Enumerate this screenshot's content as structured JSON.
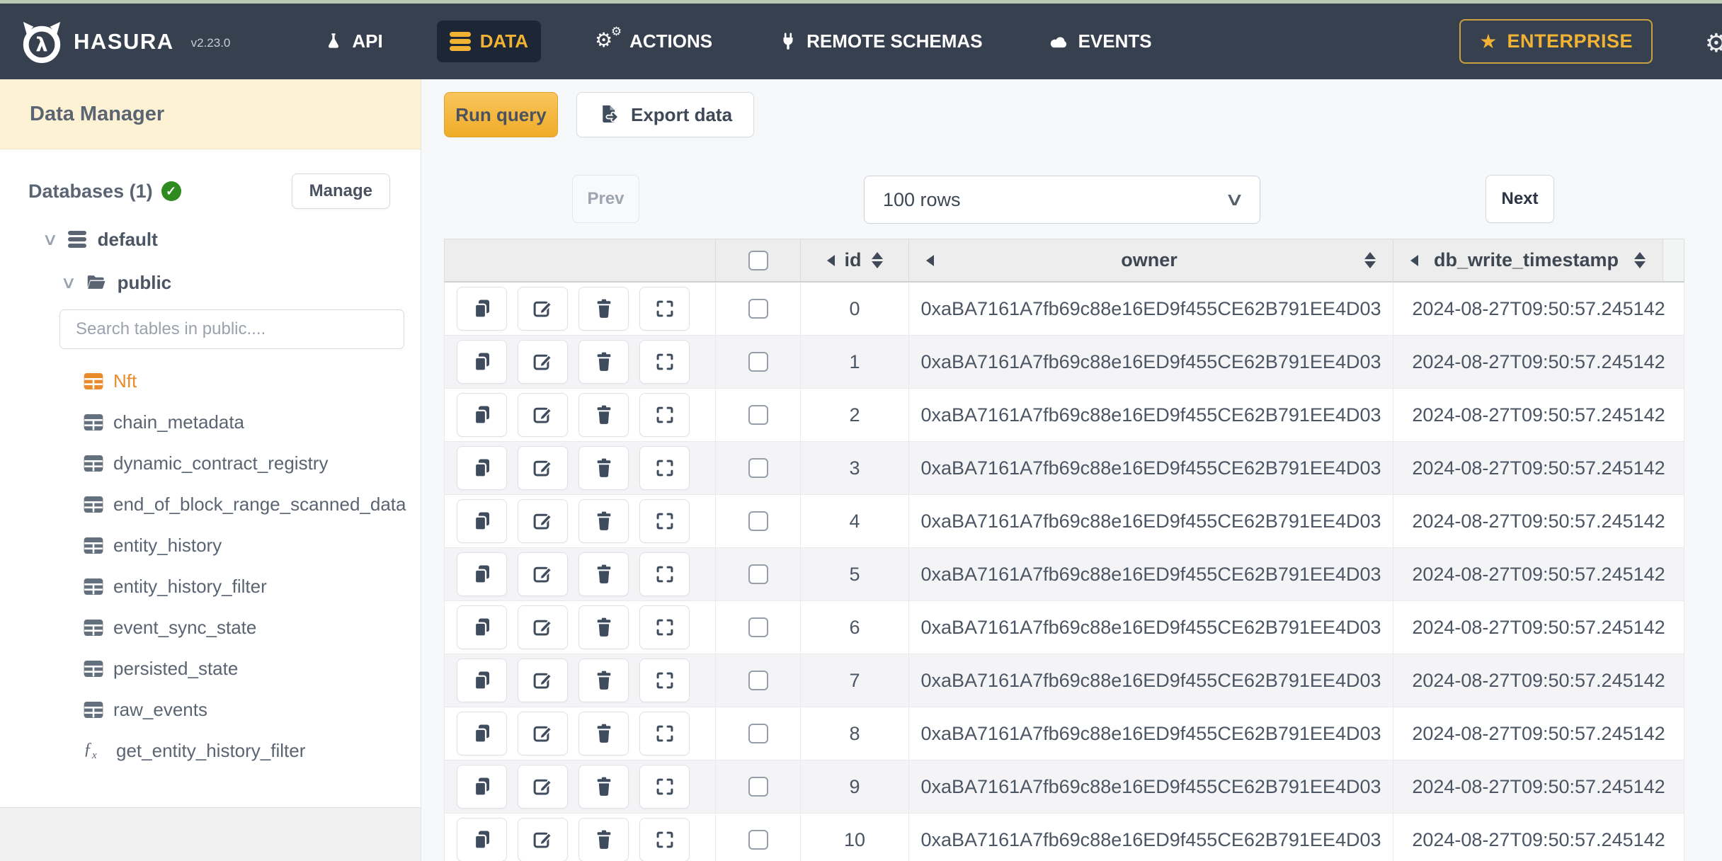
{
  "navbar": {
    "brand": "HASURA",
    "version": "v2.23.0",
    "items": [
      {
        "label": "API",
        "icon": "flask-icon",
        "active": false
      },
      {
        "label": "DATA",
        "icon": "database-icon",
        "active": true
      },
      {
        "label": "ACTIONS",
        "icon": "gears-icon",
        "active": false
      },
      {
        "label": "REMOTE SCHEMAS",
        "icon": "plug-icon",
        "active": false
      },
      {
        "label": "EVENTS",
        "icon": "cloud-icon",
        "active": false
      }
    ],
    "enterprise_label": "ENTERPRISE"
  },
  "sidebar": {
    "title": "Data Manager",
    "databases_label": "Databases (1)",
    "manage_label": "Manage",
    "tree": {
      "database": "default",
      "schema": "public"
    },
    "search_placeholder": "Search tables in public....",
    "tables": [
      {
        "name": "Nft",
        "type": "table",
        "active": true
      },
      {
        "name": "chain_metadata",
        "type": "table",
        "active": false
      },
      {
        "name": "dynamic_contract_registry",
        "type": "table",
        "active": false
      },
      {
        "name": "end_of_block_range_scanned_data",
        "type": "table",
        "active": false
      },
      {
        "name": "entity_history",
        "type": "table",
        "active": false
      },
      {
        "name": "entity_history_filter",
        "type": "table",
        "active": false
      },
      {
        "name": "event_sync_state",
        "type": "table",
        "active": false
      },
      {
        "name": "persisted_state",
        "type": "table",
        "active": false
      },
      {
        "name": "raw_events",
        "type": "table",
        "active": false
      },
      {
        "name": "get_entity_history_filter",
        "type": "function",
        "active": false
      }
    ]
  },
  "toolbar": {
    "run_query": "Run query",
    "export_data": "Export data"
  },
  "pagination": {
    "prev": "Prev",
    "rows_select_value": "100 rows",
    "next": "Next"
  },
  "table": {
    "columns": [
      {
        "key": "id",
        "label": "id"
      },
      {
        "key": "owner",
        "label": "owner"
      },
      {
        "key": "db_write_timestamp",
        "label": "db_write_timestamp"
      }
    ],
    "row_actions": [
      "copy",
      "edit",
      "delete",
      "expand"
    ],
    "rows": [
      {
        "id": "0",
        "owner": "0xaBA7161A7fb69c88e16ED9f455CE62B791EE4D03",
        "db_write_timestamp": "2024-08-27T09:50:57.245142"
      },
      {
        "id": "1",
        "owner": "0xaBA7161A7fb69c88e16ED9f455CE62B791EE4D03",
        "db_write_timestamp": "2024-08-27T09:50:57.245142"
      },
      {
        "id": "2",
        "owner": "0xaBA7161A7fb69c88e16ED9f455CE62B791EE4D03",
        "db_write_timestamp": "2024-08-27T09:50:57.245142"
      },
      {
        "id": "3",
        "owner": "0xaBA7161A7fb69c88e16ED9f455CE62B791EE4D03",
        "db_write_timestamp": "2024-08-27T09:50:57.245142"
      },
      {
        "id": "4",
        "owner": "0xaBA7161A7fb69c88e16ED9f455CE62B791EE4D03",
        "db_write_timestamp": "2024-08-27T09:50:57.245142"
      },
      {
        "id": "5",
        "owner": "0xaBA7161A7fb69c88e16ED9f455CE62B791EE4D03",
        "db_write_timestamp": "2024-08-27T09:50:57.245142"
      },
      {
        "id": "6",
        "owner": "0xaBA7161A7fb69c88e16ED9f455CE62B791EE4D03",
        "db_write_timestamp": "2024-08-27T09:50:57.245142"
      },
      {
        "id": "7",
        "owner": "0xaBA7161A7fb69c88e16ED9f455CE62B791EE4D03",
        "db_write_timestamp": "2024-08-27T09:50:57.245142"
      },
      {
        "id": "8",
        "owner": "0xaBA7161A7fb69c88e16ED9f455CE62B791EE4D03",
        "db_write_timestamp": "2024-08-27T09:50:57.245142"
      },
      {
        "id": "9",
        "owner": "0xaBA7161A7fb69c88e16ED9f455CE62B791EE4D03",
        "db_write_timestamp": "2024-08-27T09:50:57.245142"
      },
      {
        "id": "10",
        "owner": "0xaBA7161A7fb69c88e16ED9f455CE62B791EE4D03",
        "db_write_timestamp": "2024-08-27T09:50:57.245142"
      }
    ]
  },
  "icons": {
    "lambda": "λ",
    "gear": "⚙",
    "star": "★",
    "check": "✓",
    "chevron": "∨"
  },
  "colors": {
    "accent_yellow": "#f2b335",
    "accent_orange": "#e98a2b",
    "nav_bg": "#36404f",
    "nav_active_bg": "#1c2634",
    "cream": "#fdf2d4",
    "green_check": "#2f8a1f"
  }
}
